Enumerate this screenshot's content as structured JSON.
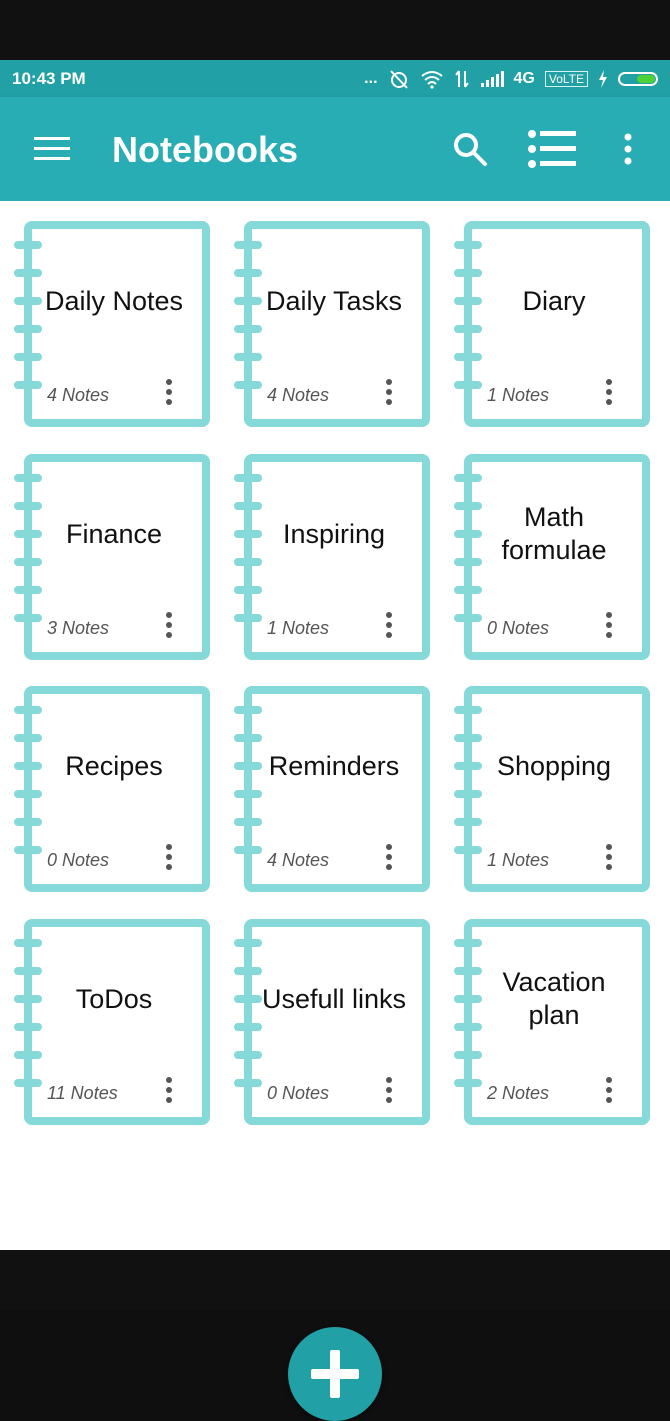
{
  "status_bar": {
    "time": "10:43 PM",
    "dots": "...",
    "network": "4G",
    "volte": "VoLTE"
  },
  "app_bar": {
    "title": "Notebooks"
  },
  "notebooks": [
    {
      "title": "Daily Notes",
      "count": "4 Notes"
    },
    {
      "title": "Daily Tasks",
      "count": "4 Notes"
    },
    {
      "title": "Diary",
      "count": "1 Notes"
    },
    {
      "title": "Finance",
      "count": "3 Notes"
    },
    {
      "title": "Inspiring",
      "count": "1 Notes"
    },
    {
      "title": "Math formulae",
      "count": "0 Notes"
    },
    {
      "title": "Recipes",
      "count": "0 Notes"
    },
    {
      "title": "Reminders",
      "count": "4 Notes"
    },
    {
      "title": "Shopping",
      "count": "1 Notes"
    },
    {
      "title": "ToDos",
      "count": "11 Notes"
    },
    {
      "title": "Usefull links",
      "count": "0 Notes"
    },
    {
      "title": "Vacation plan",
      "count": "2 Notes"
    }
  ],
  "colors": {
    "primary": "#29adb4",
    "accent": "#21a0a6",
    "notebook_outline": "#85d9d9"
  }
}
